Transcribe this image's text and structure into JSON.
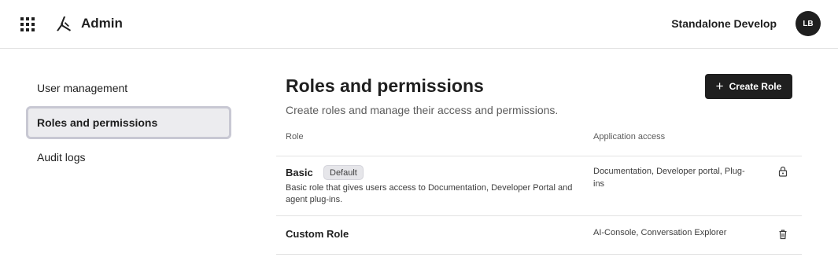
{
  "header": {
    "title": "Admin",
    "org_name": "Standalone Develop",
    "avatar_initials": "LB",
    "apps_icon": "grid-apps-icon",
    "logo_icon": "brand-logo-icon"
  },
  "sidebar": {
    "items": [
      {
        "label": "User management",
        "active": false
      },
      {
        "label": "Roles and permissions",
        "active": true
      },
      {
        "label": "Audit logs",
        "active": false
      }
    ]
  },
  "main": {
    "title": "Roles and permissions",
    "subtitle": "Create roles and manage their access and permissions.",
    "create_button_label": "Create Role",
    "create_button_icon": "plus-icon",
    "columns": {
      "role": "Role",
      "access": "Application access"
    },
    "roles": [
      {
        "name": "Basic",
        "badge": "Default",
        "description": "Basic role that gives users access to Documentation, Developer Portal and agent plug-ins.",
        "access": "Documentation, Developer portal, Plug-ins",
        "icon": "lock-icon"
      },
      {
        "name": "Custom Role",
        "badge": "",
        "description": "",
        "access": "AI-Console, Conversation Explorer",
        "icon": "trash-icon"
      }
    ]
  },
  "colors": {
    "primary": "#1f1f1f",
    "sidebar_active_bg": "#ececef",
    "sidebar_active_border": "#c8c8d3",
    "badge_bg": "#e6e6ea",
    "divider": "#e2e2e2"
  }
}
